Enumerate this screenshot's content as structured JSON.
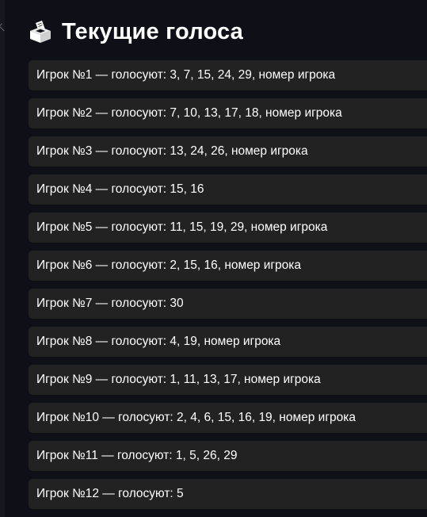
{
  "header": {
    "title": "Текущие голоса",
    "icon": "ballot-box-icon"
  },
  "votes": [
    "Игрок №1 — голосуют: 3, 7, 15, 24, 29, номер игрока",
    "Игрок №2 — голосуют: 7, 10, 13, 17, 18, номер игрока",
    "Игрок №3 — голосуют: 13, 24, 26, номер игрока",
    "Игрок №4 — голосуют: 15, 16",
    "Игрок №5 — голосуют: 11, 15, 19, 29, номер игрока",
    "Игрок №6 — голосуют: 2, 15, 16, номер игрока",
    "Игрок №7 — голосуют: 30",
    "Игрок №8 — голосуют: 4, 19, номер игрока",
    "Игрок №9 — голосуют: 1, 11, 13, 17, номер игрока",
    "Игрок №10 — голосуют: 2, 4, 6, 15, 16, 19, номер игрока",
    "Игрок №11 — голосуют: 1, 5, 26, 29",
    "Игрок №12 — голосуют: 5"
  ],
  "colors": {
    "background": "#0f0f17",
    "row": "#222222",
    "text": "#ffffff"
  }
}
